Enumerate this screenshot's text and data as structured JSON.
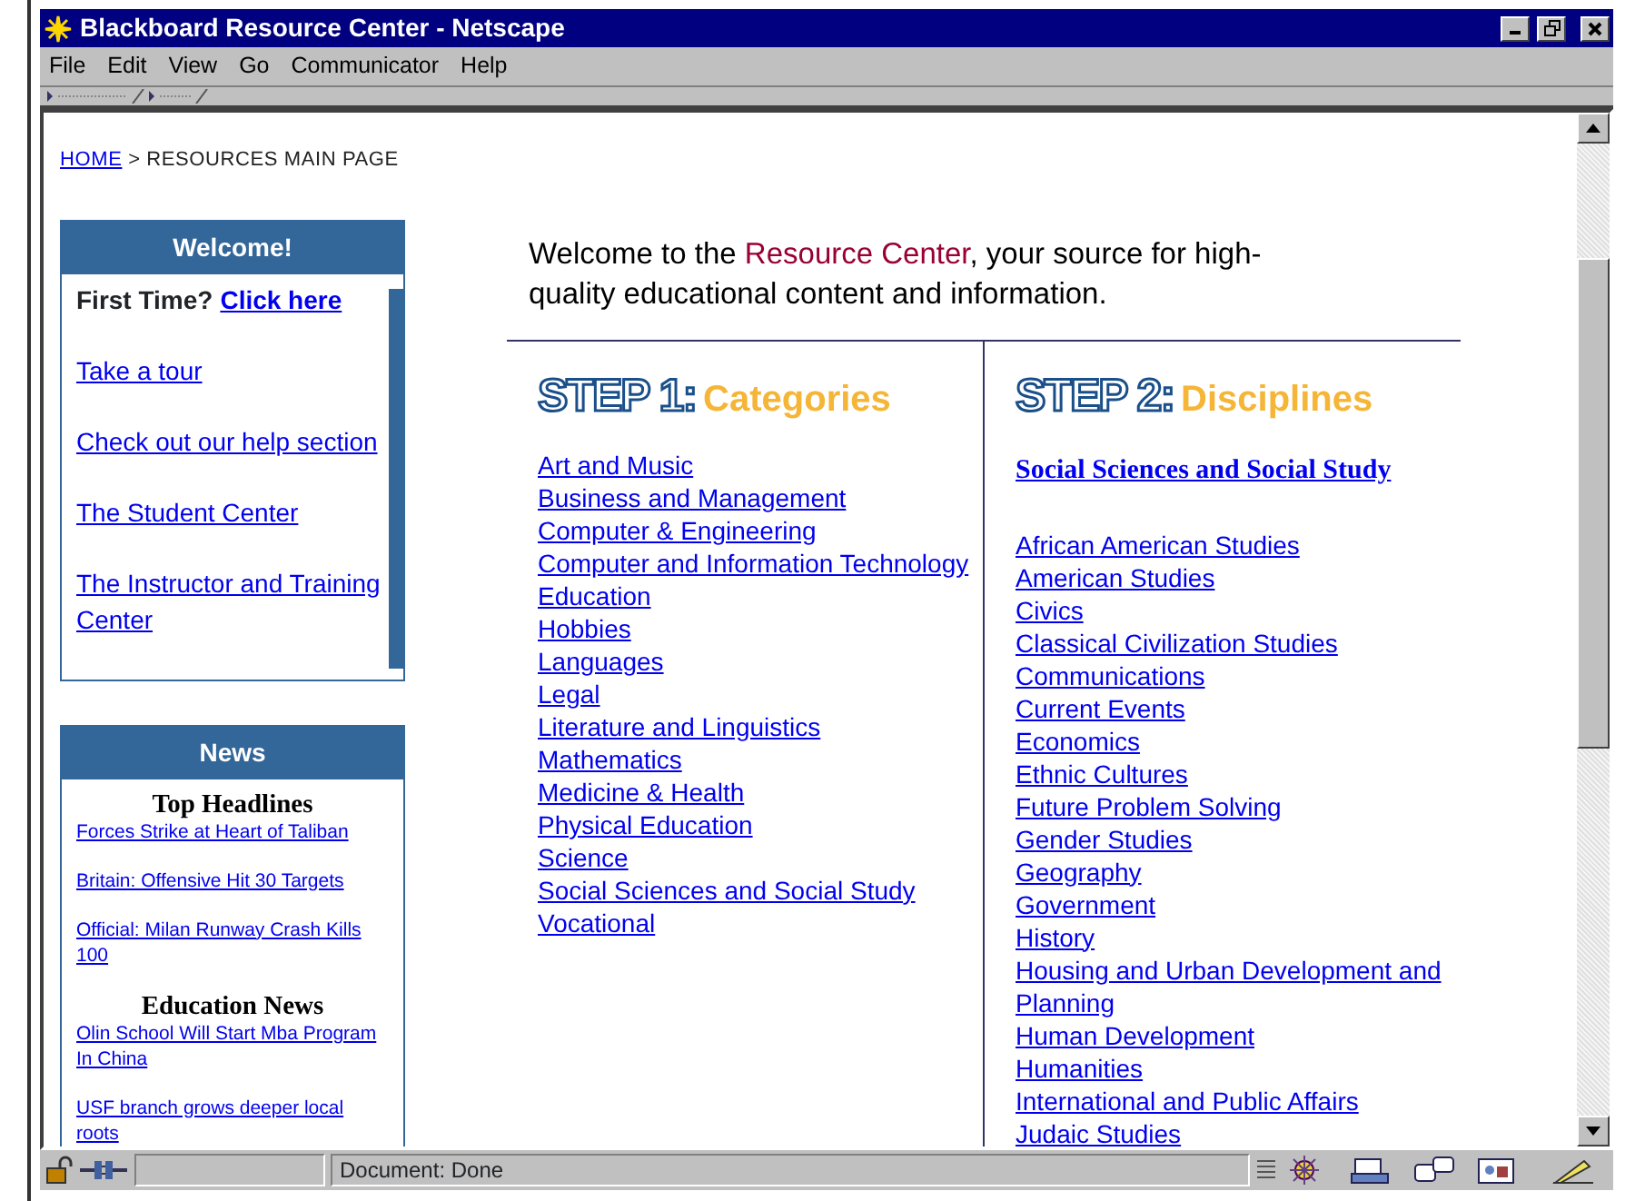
{
  "window": {
    "title": "Blackboard Resource Center - Netscape"
  },
  "menu": [
    "File",
    "Edit",
    "View",
    "Go",
    "Communicator",
    "Help"
  ],
  "breadcrumb": {
    "home": "HOME",
    "separator": ">",
    "current": "RESOURCES MAIN PAGE"
  },
  "welcome": {
    "title": "Welcome!",
    "first_time_label": "First Time?",
    "first_time_link": "Click here",
    "links": [
      "Take a tour",
      "Check out our help section",
      "The Student Center",
      "The Instructor and Training Center"
    ]
  },
  "news": {
    "title": "News",
    "sections": [
      {
        "heading": "Top Headlines",
        "links": [
          "Forces Strike at Heart of Taliban",
          "Britain: Offensive Hit 30 Targets",
          "Official: Milan Runway Crash Kills 100"
        ]
      },
      {
        "heading": "Education News",
        "links": [
          "Olin School Will Start Mba Program In China",
          "USF branch grows deeper local roots"
        ]
      }
    ]
  },
  "intro": {
    "before": "Welcome to the ",
    "highlight": "Resource Center",
    "after": ", your source for high-quality educational content and information."
  },
  "steps": [
    {
      "step_label": "STEP 1:",
      "title": "Categories",
      "links": [
        "Art and Music",
        "Business and Management",
        "Computer & Engineering",
        "Computer and Information Technology",
        "Education",
        "Hobbies",
        "Languages",
        "Legal",
        "Literature and Linguistics",
        "Mathematics",
        "Medicine & Health",
        "Physical Education",
        "Science",
        "Social Sciences and Social Study",
        "Vocational"
      ]
    },
    {
      "step_label": "STEP 2:",
      "title": "Disciplines",
      "subtitle": "Social Sciences and Social Study",
      "links": [
        "African American Studies",
        "American Studies",
        "Civics",
        "Classical Civilization Studies",
        "Communications",
        "Current Events",
        "Economics",
        "Ethnic Cultures",
        "Future Problem Solving",
        "Gender Studies",
        "Geography",
        "Government",
        "History",
        "Housing and Urban Development and Planning",
        "Human Development",
        "Humanities",
        "International and Public Affairs",
        "Judaic Studies"
      ]
    }
  ],
  "status_bar": {
    "text": "Document: Done"
  }
}
